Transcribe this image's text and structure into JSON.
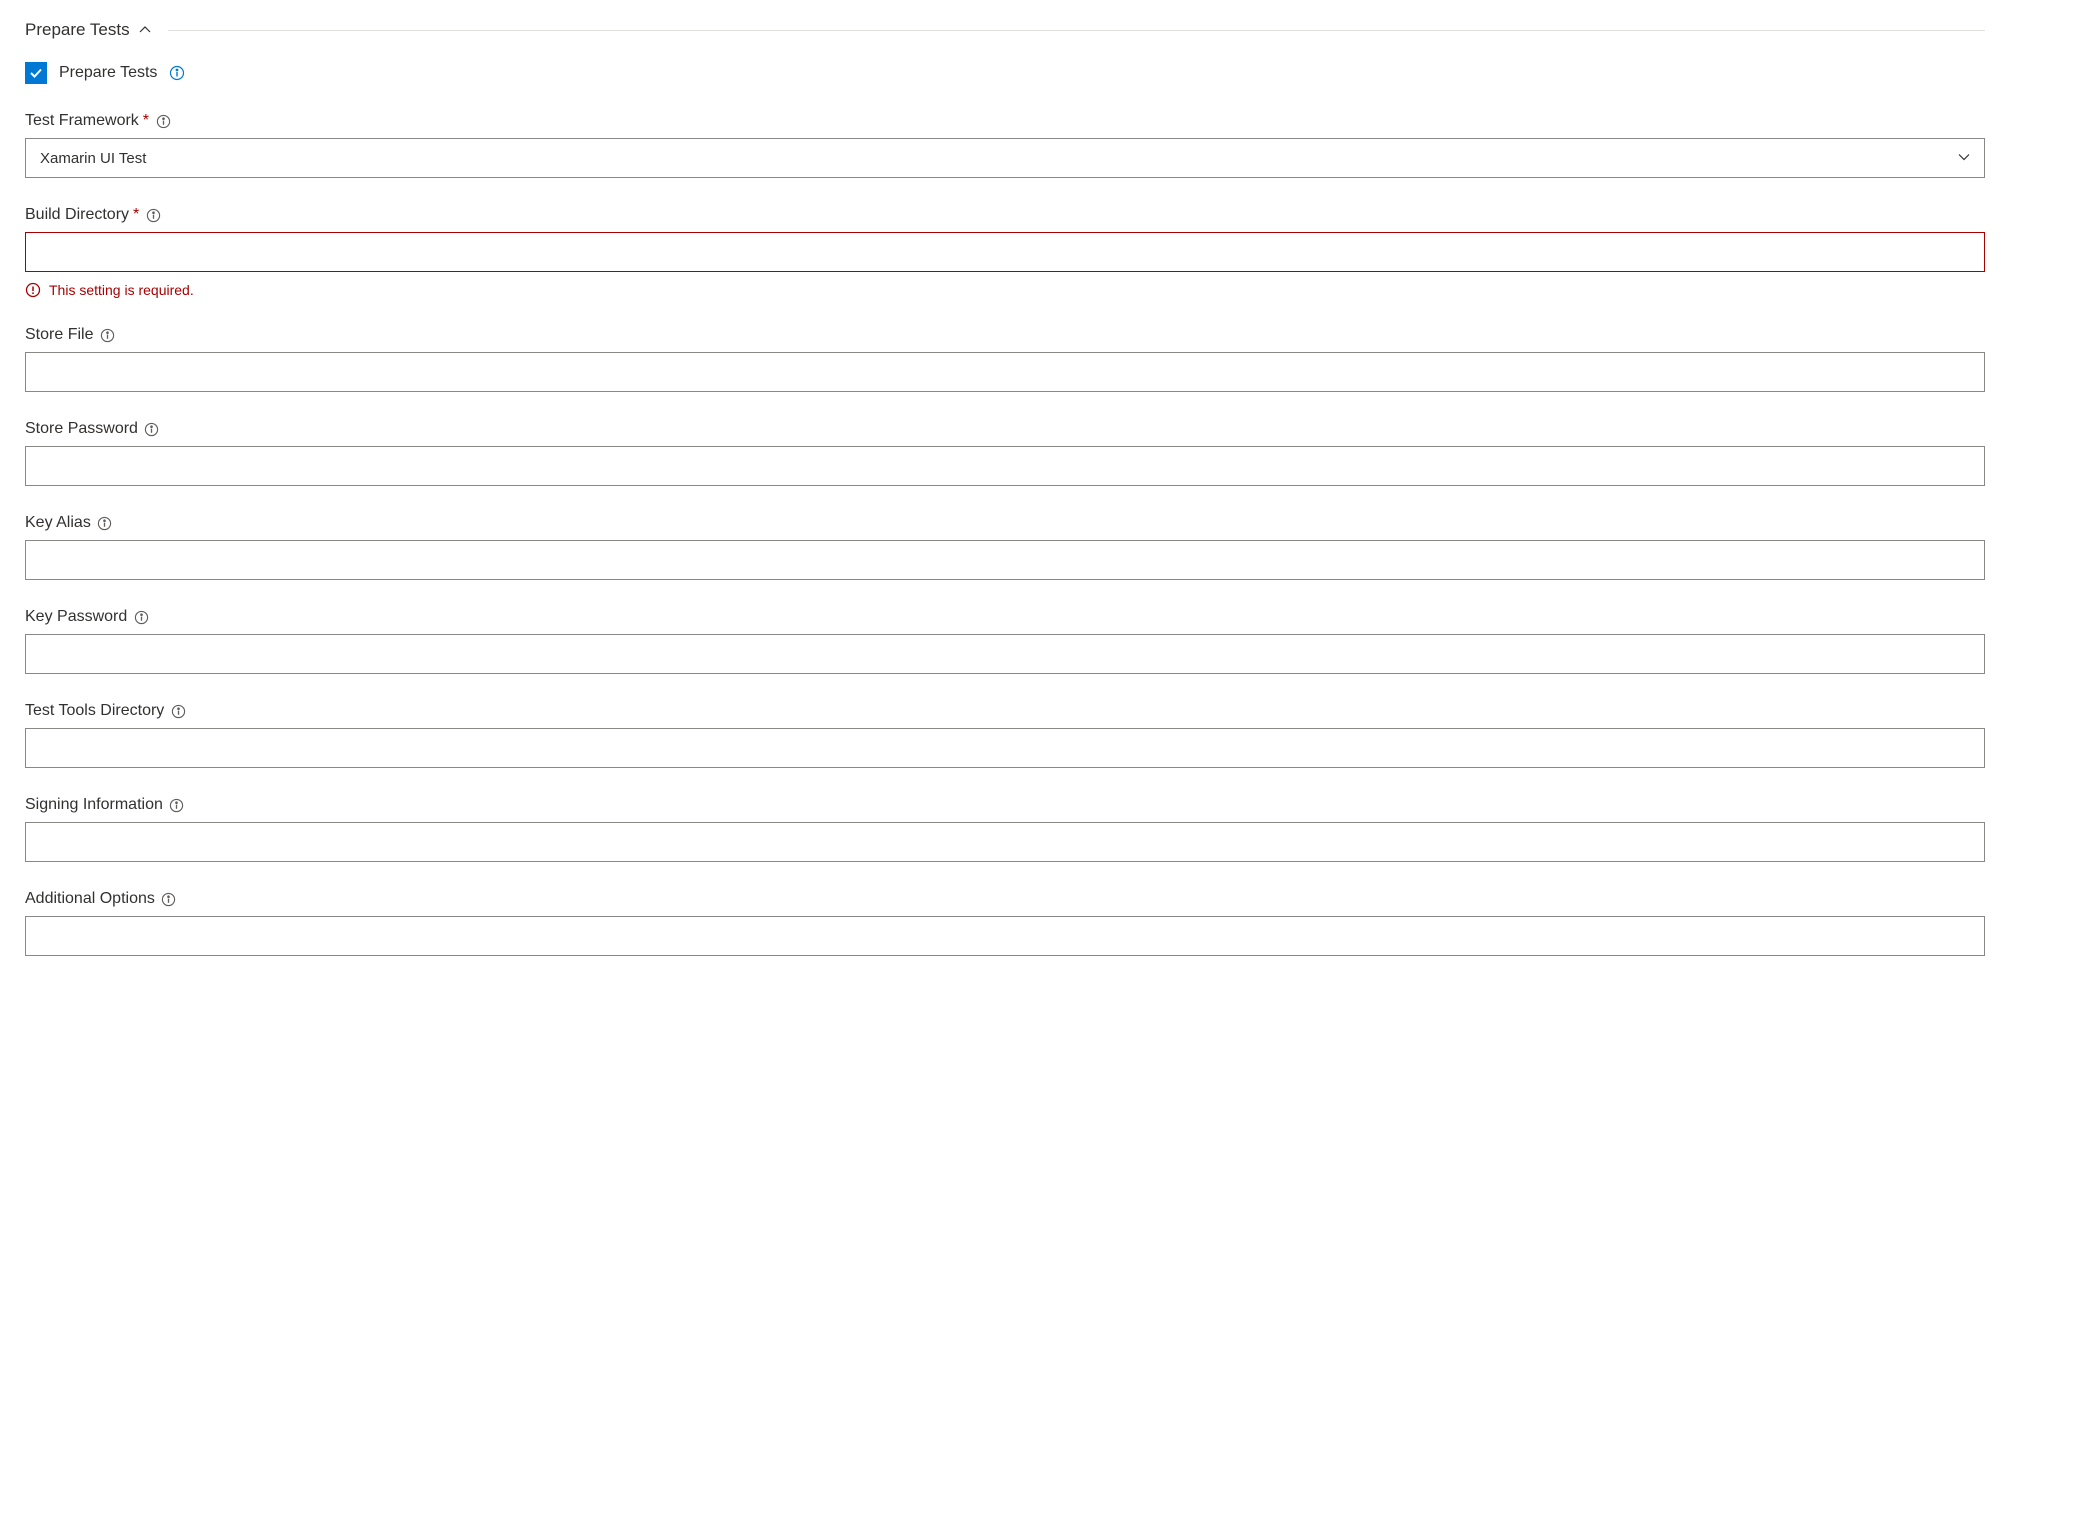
{
  "section": {
    "title": "Prepare Tests"
  },
  "checkbox": {
    "label": "Prepare Tests",
    "checked": true
  },
  "fields": {
    "testFramework": {
      "label": "Test Framework",
      "required": true,
      "value": "Xamarin UI Test"
    },
    "buildDirectory": {
      "label": "Build Directory",
      "required": true,
      "value": "",
      "error": "This setting is required."
    },
    "storeFile": {
      "label": "Store File",
      "value": ""
    },
    "storePassword": {
      "label": "Store Password",
      "value": ""
    },
    "keyAlias": {
      "label": "Key Alias",
      "value": ""
    },
    "keyPassword": {
      "label": "Key Password",
      "value": ""
    },
    "testToolsDirectory": {
      "label": "Test Tools Directory",
      "value": ""
    },
    "signingInformation": {
      "label": "Signing Information",
      "value": ""
    },
    "additionalOptions": {
      "label": "Additional Options",
      "value": ""
    }
  }
}
